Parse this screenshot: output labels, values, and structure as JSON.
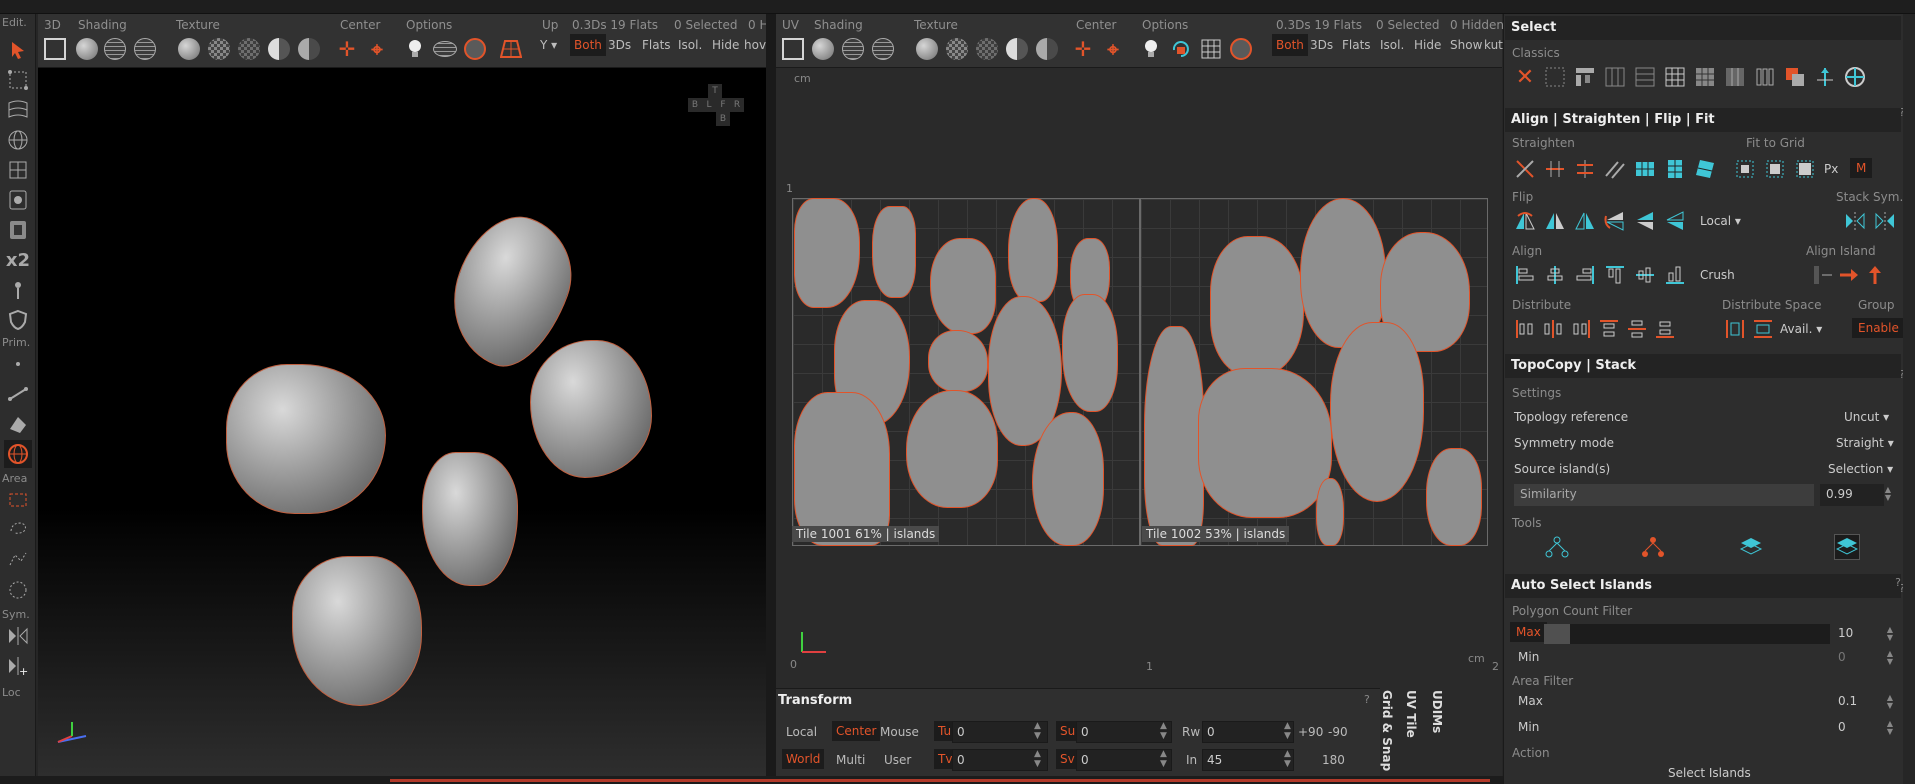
{
  "left_toolbar": {
    "labels": {
      "edit": "Edit.",
      "x2": "x2",
      "prim": "Prim.",
      "area": "Area",
      "sym": "Sym.",
      "loc": "Loc"
    }
  },
  "viewport3d": {
    "labels": [
      "3D",
      "Shading",
      "Texture",
      "Center",
      "Options",
      "Up"
    ],
    "stats": "0.3Ds 19 Flats",
    "selected": "0 Selected",
    "hidden": "0 H",
    "up_value": "Y",
    "buttons": [
      "Both",
      "3Ds",
      "Flats",
      "Isol.",
      "Hide",
      "hov"
    ],
    "gizmo": {
      "t": "T",
      "l": "L",
      "f": "F",
      "r": "R",
      "b": "B",
      "bk": "B"
    }
  },
  "viewportuv": {
    "labels": [
      "UV",
      "Shading",
      "Texture",
      "Center",
      "Options"
    ],
    "stats": "0.3Ds 19 Flats",
    "selected": "0 Selected",
    "hidden": "0 Hidden",
    "buttons": [
      "Both",
      "3Ds",
      "Flats",
      "Isol.",
      "Hide",
      "Show",
      "kut"
    ],
    "axis_unit": "cm",
    "axis_y_1": "1",
    "axis_x_0": "0",
    "axis_x_1": "1",
    "axis_x_2": "2",
    "tiles": [
      {
        "label": "Tile 1001 61% | islands"
      },
      {
        "label": "Tile 1002 53% | islands"
      }
    ]
  },
  "transform": {
    "title": "Transform",
    "hint": "?",
    "row1": {
      "local": "Local",
      "center": "Center",
      "mouse": "Mouse",
      "tu": "Tu",
      "tu_val": "0",
      "su": "Su",
      "su_val": "0",
      "rw": "Rw",
      "rw_val": "0",
      "p90": "+90",
      "m90": "-90"
    },
    "row2": {
      "world": "World",
      "multi": "Multi",
      "user": "User",
      "tv": "Tv",
      "tv_val": "0",
      "sv": "Sv",
      "sv_val": "0",
      "in": "In",
      "in_val": "45",
      "r180": "180"
    },
    "vtabs": [
      "Grid & Snap",
      "UV Tile",
      "UDIMs"
    ]
  },
  "panel": {
    "select": {
      "title": "Select",
      "classics": "Classics"
    },
    "align": {
      "title": "Align | Straighten | Flip | Fit",
      "straighten": "Straighten",
      "fit_to_grid": "Fit to Grid",
      "px": "Px",
      "m": "M",
      "flip": "Flip",
      "stack_sym": "Stack Sym.",
      "local": "Local",
      "align": "Align",
      "align_island": "Align Island",
      "crush": "Crush",
      "distribute": "Distribute",
      "distribute_space": "Distribute Space",
      "group": "Group",
      "avail": "Avail.",
      "enable": "Enable"
    },
    "topocopy": {
      "title": "TopoCopy | Stack",
      "settings": "Settings",
      "rows": [
        {
          "label": "Topology reference",
          "value": "Uncut"
        },
        {
          "label": "Symmetry mode",
          "value": "Straight"
        },
        {
          "label": "Source island(s)",
          "value": "Selection"
        }
      ],
      "similarity": "Similarity",
      "similarity_val": "0.99",
      "tools": "Tools"
    },
    "autoselect": {
      "title": "Auto Select Islands",
      "poly_filter": "Polygon Count Filter",
      "max": "Max",
      "max_val": "10",
      "min": "Min",
      "min_val": "0",
      "area_filter": "Area Filter",
      "amax": "Max",
      "amax_val": "0.1",
      "amin": "Min",
      "amin_val": "0",
      "action": "Action",
      "select_islands": "Select Islands"
    },
    "hint": "?"
  },
  "colors": {
    "accent": "#e2542a",
    "bg": "#2d2d2d",
    "cyan": "#3fc6d6"
  }
}
